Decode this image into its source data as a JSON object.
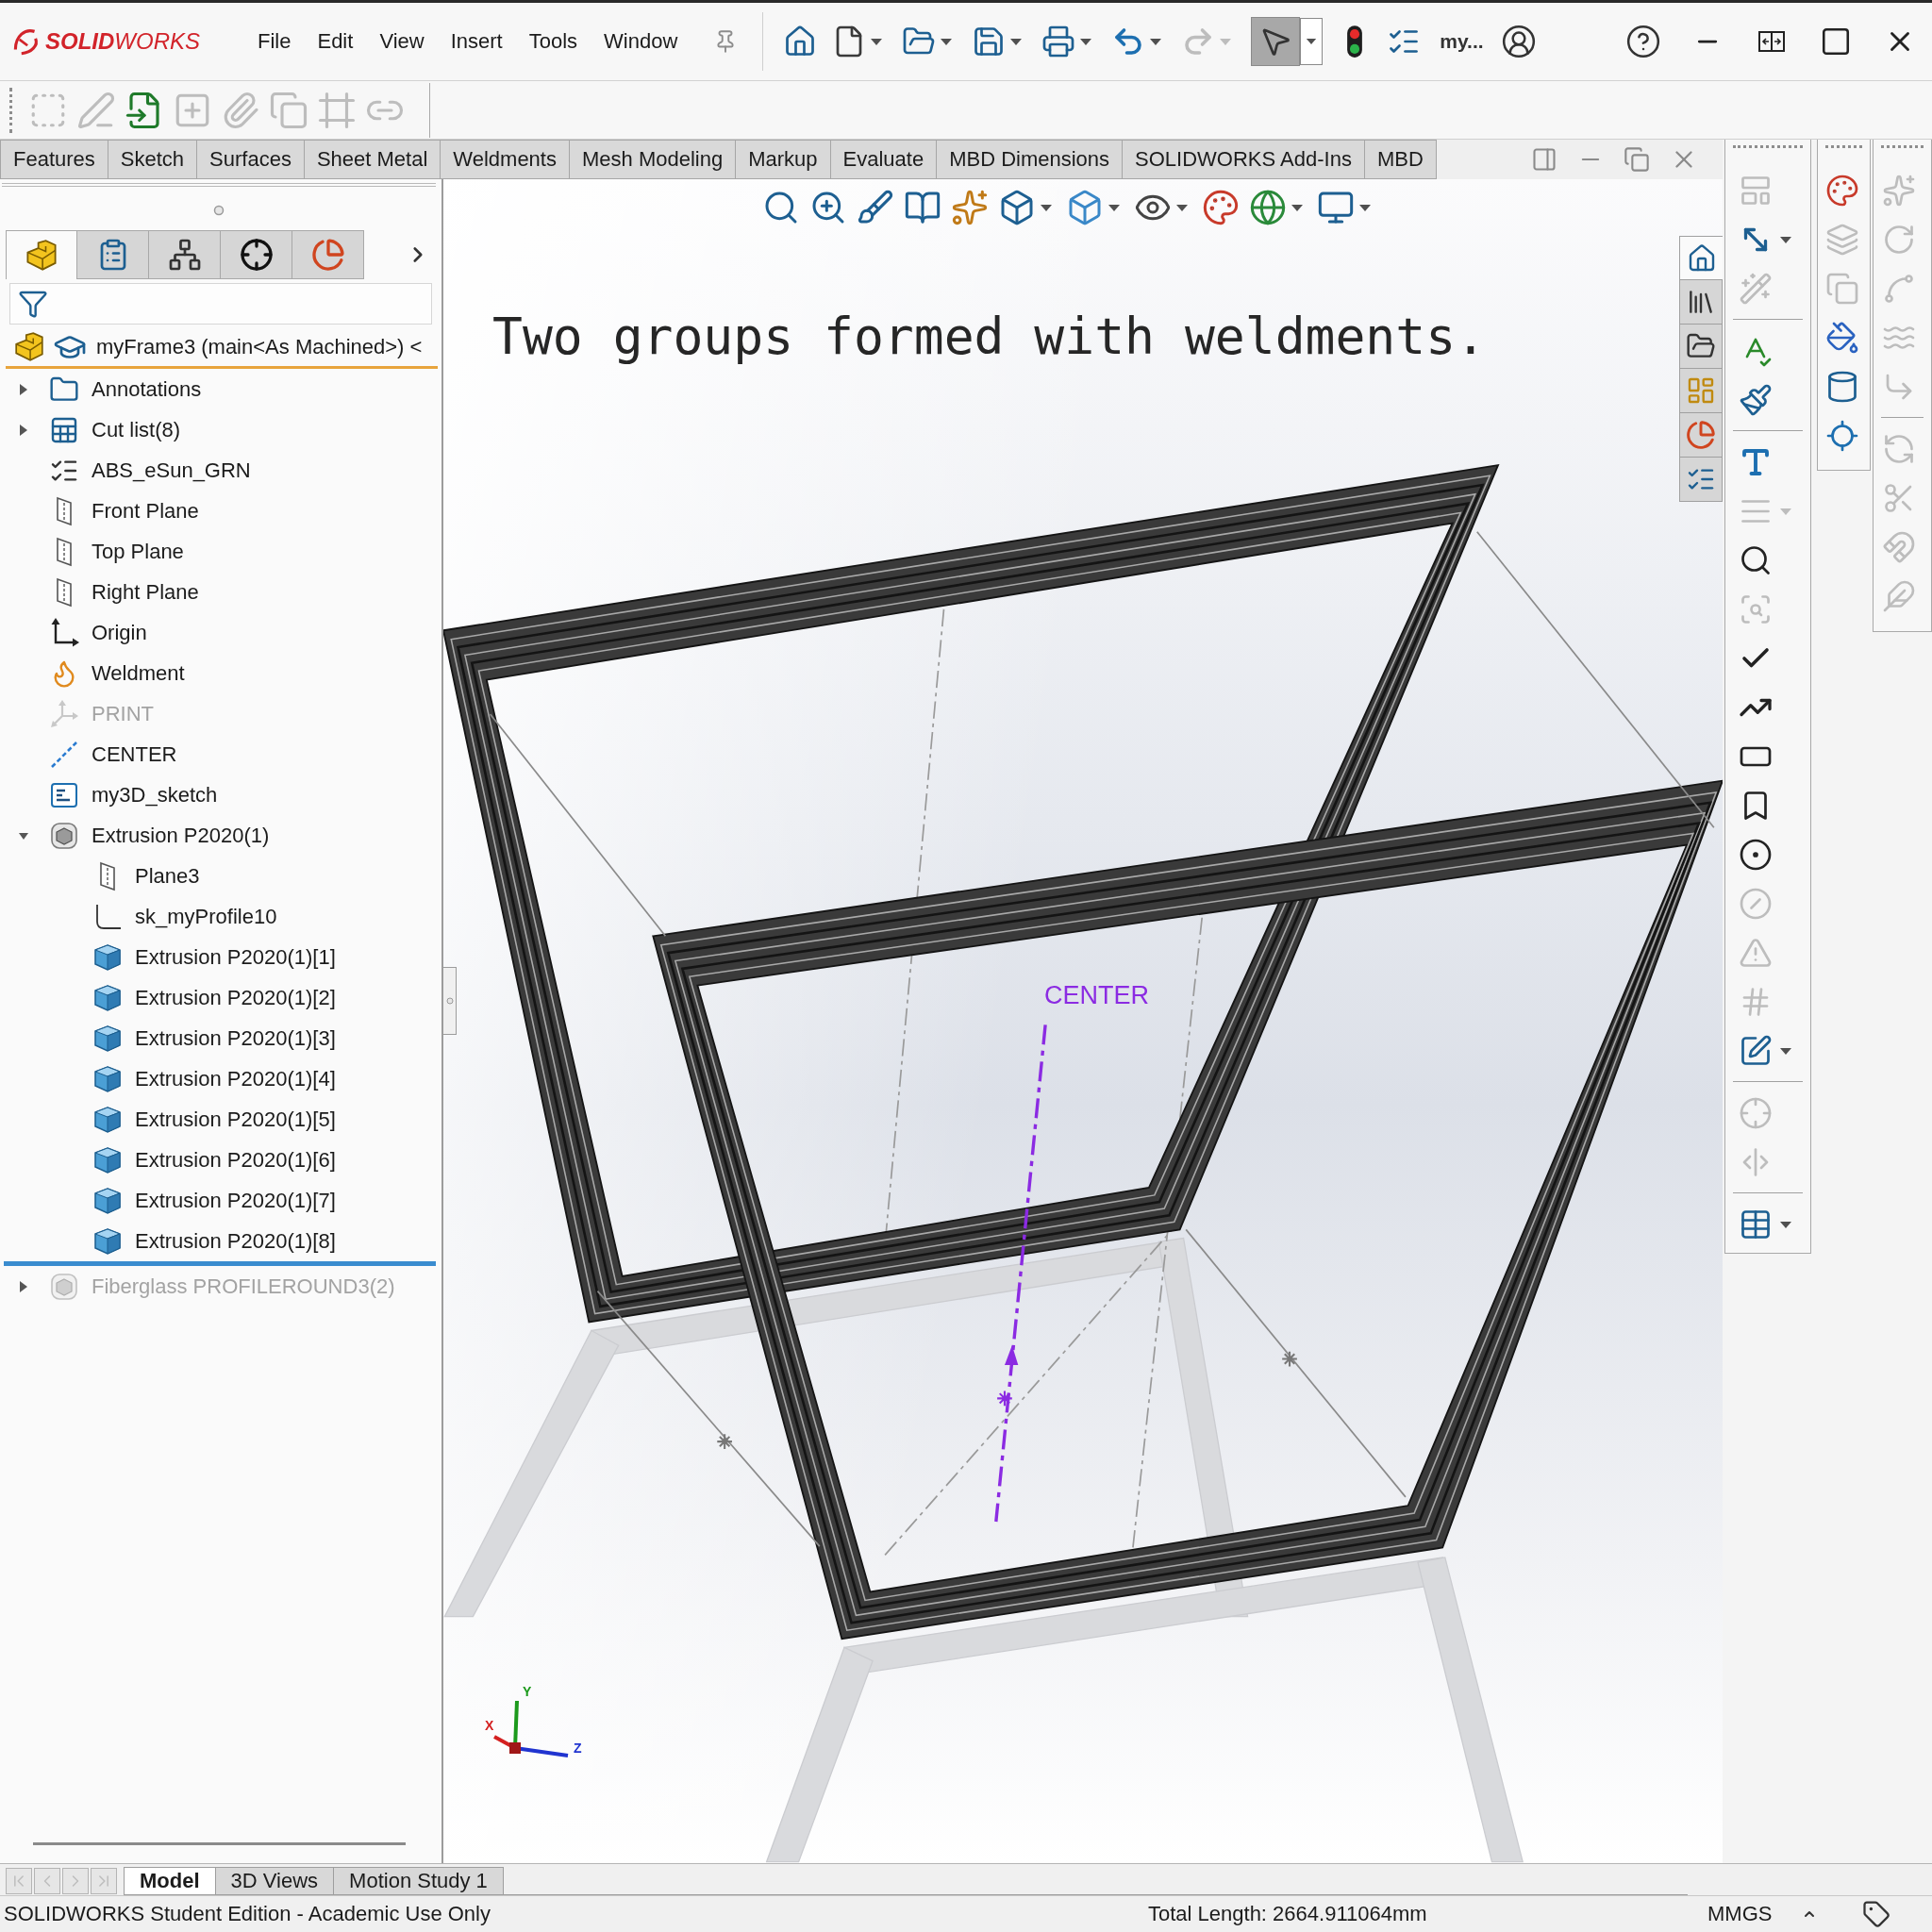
{
  "app": {
    "logo": "**SOLID**WORKS"
  },
  "menu": [
    "File",
    "Edit",
    "View",
    "Insert",
    "Tools",
    "Window"
  ],
  "quick_access": [
    {
      "kind": "home",
      "dropdown": false,
      "disabled": false,
      "pressed": false
    },
    {
      "kind": "new",
      "dropdown": true,
      "disabled": false,
      "pressed": false
    },
    {
      "kind": "open",
      "dropdown": true,
      "disabled": false,
      "pressed": false
    },
    {
      "kind": "save",
      "dropdown": true,
      "disabled": false,
      "pressed": false
    },
    {
      "kind": "print",
      "dropdown": true,
      "disabled": false,
      "pressed": false
    },
    {
      "kind": "undo",
      "dropdown": true,
      "disabled": false,
      "pressed": false
    },
    {
      "kind": "redo",
      "dropdown": true,
      "disabled": true,
      "pressed": false
    },
    {
      "kind": "select",
      "dropdown": true,
      "disabled": false,
      "pressed": true
    },
    {
      "kind": "rebuild",
      "dropdown": false,
      "disabled": false,
      "pressed": false
    },
    {
      "kind": "options",
      "dropdown": false,
      "disabled": false,
      "pressed": false
    }
  ],
  "document_name": "my...",
  "annotation_toolbar": [
    {
      "kind": "insert_note",
      "disabled": true
    },
    {
      "kind": "edit_note",
      "disabled": true
    },
    {
      "kind": "import_annotations",
      "disabled": false
    },
    {
      "kind": "add_annotation",
      "disabled": true
    },
    {
      "kind": "attach",
      "disabled": true
    },
    {
      "kind": "copy_annotations",
      "disabled": true
    },
    {
      "kind": "frame_annotation",
      "disabled": true
    },
    {
      "kind": "link",
      "disabled": true
    }
  ],
  "tabs": [
    {
      "label": "Features",
      "selected": false
    },
    {
      "label": "Sketch",
      "selected": false
    },
    {
      "label": "Surfaces",
      "selected": false
    },
    {
      "label": "Sheet Metal",
      "selected": false
    },
    {
      "label": "Weldments",
      "selected": false
    },
    {
      "label": "Mesh Modeling",
      "selected": false
    },
    {
      "label": "Markup",
      "selected": false
    },
    {
      "label": "Evaluate",
      "selected": false
    },
    {
      "label": "MBD Dimensions",
      "selected": false
    },
    {
      "label": "SOLIDWORKS Add-Ins",
      "selected": false
    },
    {
      "label": "MBD",
      "selected": false
    }
  ],
  "panel_tabs": [
    {
      "kind": "feature_manager",
      "selected": true
    },
    {
      "kind": "property_manager",
      "selected": false
    },
    {
      "kind": "configuration_manager",
      "selected": false
    },
    {
      "kind": "dimxpert_manager",
      "selected": false
    },
    {
      "kind": "display_manager",
      "selected": false
    }
  ],
  "tree": {
    "root": {
      "label": "myFrame3 (main<As Machined>) <"
    },
    "items": [
      {
        "label": "Annotations",
        "kind": "annotations",
        "expanded": false,
        "hidden": false,
        "rolled_back": false
      },
      {
        "label": "Cut list(8)",
        "kind": "cut_list",
        "expanded": false,
        "hidden": false,
        "rolled_back": false
      },
      {
        "label": "ABS_eSun_GRN",
        "kind": "material",
        "hidden": false,
        "rolled_back": false
      },
      {
        "label": "Front Plane",
        "kind": "plane",
        "hidden": false,
        "rolled_back": false
      },
      {
        "label": "Top Plane",
        "kind": "plane",
        "hidden": false,
        "rolled_back": false
      },
      {
        "label": "Right Plane",
        "kind": "plane",
        "hidden": false,
        "rolled_back": false
      },
      {
        "label": "Origin",
        "kind": "origin",
        "hidden": false,
        "rolled_back": false
      },
      {
        "label": "Weldment",
        "kind": "weldment",
        "hidden": false,
        "rolled_back": false
      },
      {
        "label": "PRINT",
        "kind": "coordinate_system",
        "hidden": true,
        "rolled_back": false
      },
      {
        "label": "CENTER",
        "kind": "axis",
        "hidden": false,
        "rolled_back": false
      },
      {
        "label": "my3D_sketch",
        "kind": "sketch_3d",
        "hidden": false,
        "rolled_back": false
      },
      {
        "label": "Extrusion P2020(1)",
        "kind": "structural_member",
        "expanded": true,
        "hidden": false,
        "rolled_back": false,
        "children": [
          {
            "label": "Plane3",
            "kind": "plane",
            "hidden": false,
            "rolled_back": false
          },
          {
            "label": "sk_myProfile10",
            "kind": "sketch",
            "hidden": false,
            "rolled_back": false
          },
          {
            "label": "Extrusion P2020(1)[1]",
            "kind": "body",
            "hidden": false,
            "rolled_back": false
          },
          {
            "label": "Extrusion P2020(1)[2]",
            "kind": "body",
            "hidden": false,
            "rolled_back": false
          },
          {
            "label": "Extrusion P2020(1)[3]",
            "kind": "body",
            "hidden": false,
            "rolled_back": false
          },
          {
            "label": "Extrusion P2020(1)[4]",
            "kind": "body",
            "hidden": false,
            "rolled_back": false
          },
          {
            "label": "Extrusion P2020(1)[5]",
            "kind": "body",
            "hidden": false,
            "rolled_back": false
          },
          {
            "label": "Extrusion P2020(1)[6]",
            "kind": "body",
            "hidden": false,
            "rolled_back": false
          },
          {
            "label": "Extrusion P2020(1)[7]",
            "kind": "body",
            "hidden": false,
            "rolled_back": false
          },
          {
            "label": "Extrusion P2020(1)[8]",
            "kind": "body",
            "hidden": false,
            "rolled_back": false
          }
        ]
      },
      {
        "label": "Fiberglass PROFILEROUND3(2)",
        "kind": "structural_member",
        "expanded": false,
        "hidden": false,
        "rolled_back": true
      }
    ]
  },
  "viewport": {
    "heading": "Two groups formed with weldments.",
    "center_label": "CENTER",
    "heads_up": [
      {
        "kind": "zoom_fit",
        "dropdown": false
      },
      {
        "kind": "zoom_area",
        "dropdown": false
      },
      {
        "kind": "previous_view",
        "dropdown": false
      },
      {
        "kind": "section_view",
        "dropdown": false
      },
      {
        "kind": "dynamic_annotation",
        "dropdown": false
      },
      {
        "kind": "view_orientation",
        "dropdown": true
      },
      {
        "kind": "display_style",
        "dropdown": true
      },
      {
        "kind": "hide_show",
        "dropdown": true
      },
      {
        "kind": "edit_appearance",
        "dropdown": false
      },
      {
        "kind": "apply_scene",
        "dropdown": true
      },
      {
        "kind": "view_settings",
        "dropdown": true
      }
    ],
    "task_pane": [
      {
        "kind": "home",
        "selected": true
      },
      {
        "kind": "resources",
        "selected": false
      },
      {
        "kind": "design_library",
        "selected": false
      },
      {
        "kind": "file_explorer",
        "selected": false
      },
      {
        "kind": "appearances",
        "selected": false
      },
      {
        "kind": "custom_properties",
        "selected": false
      }
    ],
    "triad": [
      {
        "label": "X",
        "color": "#d42020"
      },
      {
        "label": "Y",
        "color": "#1c9a1c"
      },
      {
        "label": "Z",
        "color": "#2034d0"
      }
    ]
  },
  "right_toolbars": [
    {
      "items": [
        {
          "kind": "model_items",
          "disabled": true,
          "dropdown": false
        },
        {
          "kind": "smart_dimension",
          "disabled": false,
          "dropdown": true
        },
        {
          "kind": "auto_arrange",
          "disabled": true,
          "dropdown": false
        },
        {
          "kind": "separator"
        },
        {
          "kind": "spell_check",
          "disabled": false,
          "dropdown": false
        },
        {
          "kind": "format_painter",
          "disabled": false,
          "dropdown": false
        },
        {
          "kind": "separator"
        },
        {
          "kind": "note",
          "disabled": false,
          "dropdown": false
        },
        {
          "kind": "note_pattern",
          "disabled": true,
          "dropdown": true
        },
        {
          "kind": "balloon",
          "disabled": false,
          "dropdown": false
        },
        {
          "kind": "auto_balloon",
          "disabled": true,
          "dropdown": false
        },
        {
          "kind": "surface_finish",
          "disabled": false,
          "dropdown": false
        },
        {
          "kind": "weld_symbol",
          "disabled": false,
          "dropdown": false
        },
        {
          "kind": "geometric_tolerance",
          "disabled": false,
          "dropdown": false
        },
        {
          "kind": "datum_feature",
          "disabled": false,
          "dropdown": false
        },
        {
          "kind": "datum_target",
          "disabled": false,
          "dropdown": false
        },
        {
          "kind": "hole_callout",
          "disabled": true,
          "dropdown": false
        },
        {
          "kind": "revision_symbol",
          "disabled": true,
          "dropdown": false
        },
        {
          "kind": "area_hatch",
          "disabled": true,
          "dropdown": false
        },
        {
          "kind": "blocks",
          "disabled": false,
          "dropdown": true
        },
        {
          "kind": "separator"
        },
        {
          "kind": "center_mark",
          "disabled": true,
          "dropdown": false
        },
        {
          "kind": "centerline",
          "disabled": true,
          "dropdown": false
        },
        {
          "kind": "separator"
        },
        {
          "kind": "table",
          "disabled": false,
          "dropdown": true
        }
      ]
    },
    {
      "items": [
        {
          "kind": "edit_appearance",
          "disabled": false,
          "dropdown": false
        },
        {
          "kind": "copy_appearance",
          "disabled": true,
          "dropdown": false
        },
        {
          "kind": "paste_appearance",
          "disabled": true,
          "dropdown": false
        },
        {
          "kind": "scene",
          "disabled": false,
          "dropdown": false
        },
        {
          "kind": "decal",
          "disabled": false,
          "dropdown": false
        },
        {
          "kind": "target",
          "disabled": false,
          "dropdown": false
        }
      ]
    },
    {
      "items": [
        {
          "kind": "arc",
          "disabled": true,
          "dropdown": false
        },
        {
          "kind": "circle",
          "disabled": true,
          "dropdown": false
        },
        {
          "kind": "spline",
          "disabled": true,
          "dropdown": false
        },
        {
          "kind": "offset",
          "disabled": true,
          "dropdown": false
        },
        {
          "kind": "fillet",
          "disabled": true,
          "dropdown": false
        },
        {
          "kind": "separator"
        },
        {
          "kind": "rotate",
          "disabled": true,
          "dropdown": false
        },
        {
          "kind": "trim",
          "disabled": true,
          "dropdown": false
        },
        {
          "kind": "extend",
          "disabled": true,
          "dropdown": false
        },
        {
          "kind": "split",
          "disabled": true,
          "dropdown": false
        }
      ]
    }
  ],
  "bottom_tabs": [
    {
      "label": "Model",
      "selected": true
    },
    {
      "label": "3D Views",
      "selected": false
    },
    {
      "label": "Motion Study 1",
      "selected": false
    }
  ],
  "status_bar": {
    "edition": "SOLIDWORKS Student Edition - Academic Use Only",
    "total_length": "Total Length: 2664.911064mm",
    "units": "MMGS"
  }
}
